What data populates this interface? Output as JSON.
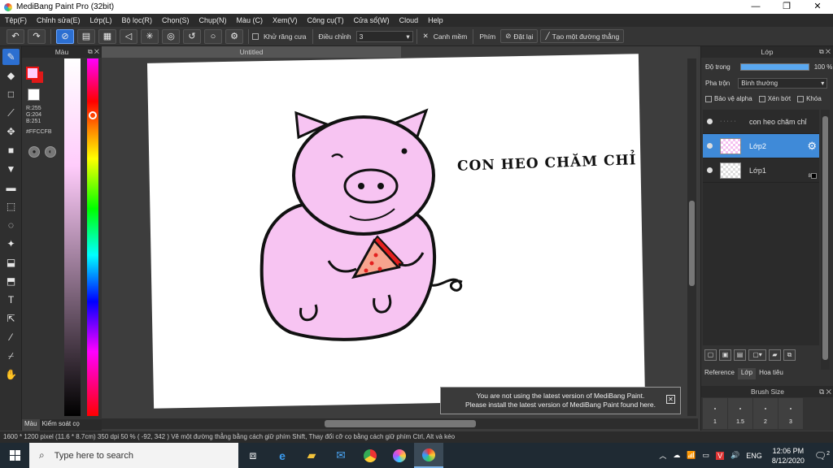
{
  "window": {
    "title": "MediBang Paint Pro (32bit)",
    "minimize": "—",
    "maximize": "❐",
    "close": "✕"
  },
  "menu": [
    "Tệp(F)",
    "Chỉnh sửa(E)",
    "Lớp(L)",
    "Bộ lọc(R)",
    "Chọn(S)",
    "Chụp(N)",
    "Màu (C)",
    "Xem(V)",
    "Công cụ(T)",
    "Cửa sổ(W)",
    "Cloud",
    "Help"
  ],
  "toolbar": {
    "antialias_label": "Khử răng cưa",
    "adjust_label": "Điều chỉnh",
    "adjust_value": "3",
    "snap_label": "Canh mềm",
    "key_label": "Phím",
    "reset_label": "Đặt lại",
    "make_line_label": "Tạo một đường thẳng"
  },
  "color_panel": {
    "title": "Màu",
    "r": "R:255",
    "g": "G:204",
    "b": "B:251",
    "hex": "#FFCCFB",
    "tab_color": "Màu",
    "tab_brush_control": "Kiểm soát cọ"
  },
  "canvas": {
    "doc_title": "Untitled",
    "drawing_text": "CON HEO CHĂM CHỈ"
  },
  "notice": {
    "line1": "You are not using the latest version of MediBang Paint.",
    "line2": "Please install the latest version of MediBang Paint found here."
  },
  "layer_panel": {
    "title": "Lớp",
    "opacity_label": "Độ trong",
    "opacity_value": "100 %",
    "opacity_fraction": 1.0,
    "blend_label": "Pha trộn",
    "blend_value": "Bình thường",
    "protect_alpha": "Bảo vệ alpha",
    "clipping": "Xén bớt",
    "lock": "Khóa",
    "layers": [
      {
        "name": "con heo chăm chỉ",
        "selected": false
      },
      {
        "name": "Lớp2",
        "selected": true
      },
      {
        "name": "Lớp1",
        "selected": false,
        "badge": "8"
      }
    ],
    "tabs": [
      "Reference",
      "Lớp",
      "Hoa tiêu"
    ]
  },
  "brush_size": {
    "title": "Brush Size",
    "sizes": [
      "1",
      "1.5",
      "2",
      "3"
    ]
  },
  "status": {
    "text": "1600 * 1200 pixel   (11.6 * 8.7cm)   350 dpi   50 %   ( -92, 342 )   Vẽ một đường thẳng bằng cách giữ phím Shift, Thay đổi cỡ cọ bằng cách giữ phím Ctrl, Alt và kéo"
  },
  "taskbar": {
    "search_placeholder": "Type here to search",
    "lang": "ENG",
    "time": "12:06 PM",
    "date": "8/12/2020",
    "notif_count": "2"
  }
}
